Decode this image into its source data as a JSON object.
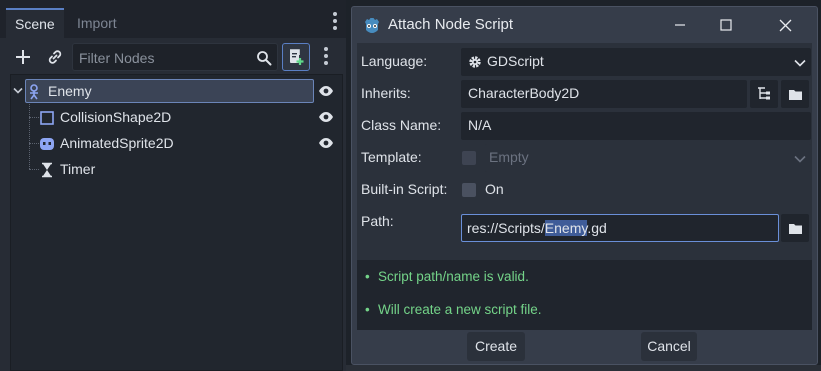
{
  "scene_dock": {
    "tabs": [
      {
        "label": "Scene",
        "active": true
      },
      {
        "label": "Import",
        "active": false
      }
    ],
    "filter": {
      "placeholder": "Filter Nodes",
      "value": ""
    },
    "tree": [
      {
        "label": "Enemy",
        "icon": "character-body-icon",
        "selected": true,
        "visible_toggle": true
      },
      {
        "label": "CollisionShape2D",
        "icon": "collision-shape-icon",
        "selected": false,
        "visible_toggle": true
      },
      {
        "label": "AnimatedSprite2D",
        "icon": "animated-sprite-icon",
        "selected": false,
        "visible_toggle": true
      },
      {
        "label": "Timer",
        "icon": "hourglass-icon",
        "selected": false,
        "visible_toggle": false
      }
    ]
  },
  "dialog": {
    "title": "Attach Node Script",
    "fields": {
      "language": {
        "label": "Language:",
        "value": "GDScript"
      },
      "inherits": {
        "label": "Inherits:",
        "value": "CharacterBody2D"
      },
      "class_name": {
        "label": "Class Name:",
        "value": "N/A"
      },
      "template": {
        "label": "Template:",
        "value": "Empty",
        "enabled": false
      },
      "builtin": {
        "label": "Built-in Script:",
        "value": "On",
        "checked": false
      },
      "path": {
        "label": "Path:",
        "prefix": "res://Scripts/",
        "selected": "Enemy",
        "suffix": ".gd"
      }
    },
    "messages": [
      "Script path/name is valid.",
      "Will create a new script file."
    ],
    "buttons": {
      "create": "Create",
      "cancel": "Cancel"
    }
  },
  "colors": {
    "accent": "#6a8fd8",
    "valid_message": "#74d489",
    "selected_row": "#3b4456",
    "node_icon_blue": "#8da5f3"
  }
}
